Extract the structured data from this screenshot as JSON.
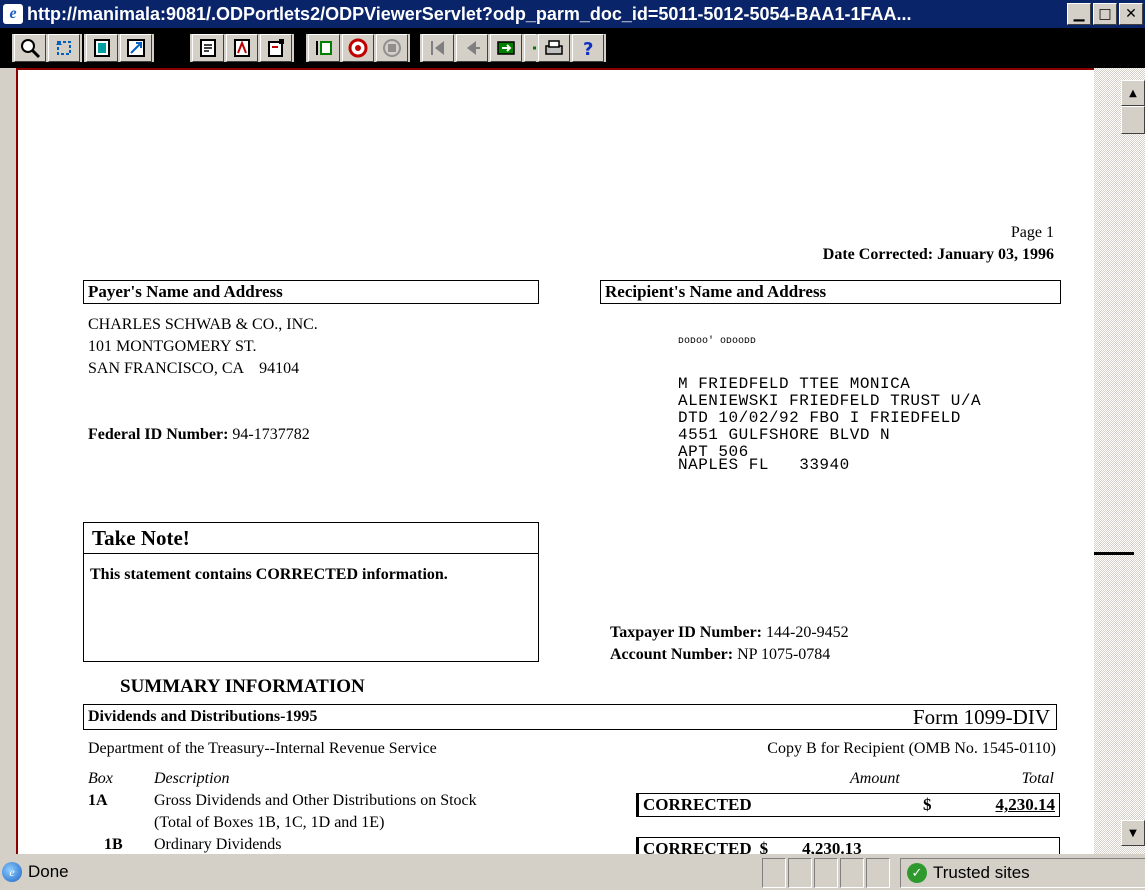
{
  "window": {
    "title": "http://manimala:9081/.ODPortlets2/ODPViewerServlet?odp_parm_doc_id=5011-5012-5054-BAA1-1FAA...",
    "minimize": "▁",
    "maximize": "□",
    "close": "✕"
  },
  "toolbar": {
    "buttons": [
      "zoom",
      "refresh",
      "page-view",
      "fit",
      "find",
      "annotate",
      "notes",
      "first-doc",
      "stop",
      "disabled",
      "first-page",
      "prev-page",
      "next",
      "last-page",
      "print",
      "help"
    ]
  },
  "document": {
    "page_label": "Page 1",
    "date_corrected": "Date Corrected: January 03, 1996",
    "payer_header": "Payer's Name and Address",
    "recipient_header": "Recipient's Name and Address",
    "payer_lines": [
      "CHARLES SCHWAB & CO., INC.",
      "101 MONTGOMERY ST.",
      "SAN FRANCISCO, CA    94104"
    ],
    "federal_id_label": "Federal ID Number:",
    "federal_id_value": "94-1737782",
    "barcode": "ᴅᴏᴅᴏᴏ' ᴏᴅᴏᴏᴅᴅ",
    "recipient_lines": [
      "M FRIEDFELD TTEE MONICA",
      "ALENIEWSKI FRIEDFELD TRUST U/A",
      "DTD 10/02/92 FBO I FRIEDFELD",
      "4551 GULFSHORE BLVD N",
      "APT 506",
      "NAPLES FL   33940"
    ],
    "take_note_title": "Take Note!",
    "take_note_body": "This statement contains CORRECTED information.",
    "taxpayer_label": "Taxpayer ID Number:",
    "taxpayer_value": "144-20-9452",
    "account_label": "Account Number:",
    "account_value": "NP 1075-0784",
    "summary_title": "SUMMARY INFORMATION",
    "section_header": "Dividends and Distributions-1995",
    "form_name": "Form 1099-DIV",
    "department": "Department of the Treasury--Internal Revenue Service",
    "copy_b": "Copy B for Recipient (OMB No. 1545-0110)",
    "col_box": "Box",
    "col_description": "Description",
    "col_amount": "Amount",
    "col_total": "Total",
    "row1_box": "1A",
    "row1_desc_line1": "Gross Dividends and Other Distributions on Stock",
    "row1_desc_line2": "(Total of Boxes 1B, 1C, 1D and 1E)",
    "row1_corrected": "CORRECTED",
    "row1_currency": "$",
    "row1_total": "4,230.14",
    "row2_box": "1B",
    "row2_desc": "Ordinary Dividends",
    "row2_corrected": "CORRECTED",
    "row2_currency": "$",
    "row2_amount": "4,230.13"
  },
  "status": {
    "done": "Done",
    "zone": "Trusted sites"
  }
}
